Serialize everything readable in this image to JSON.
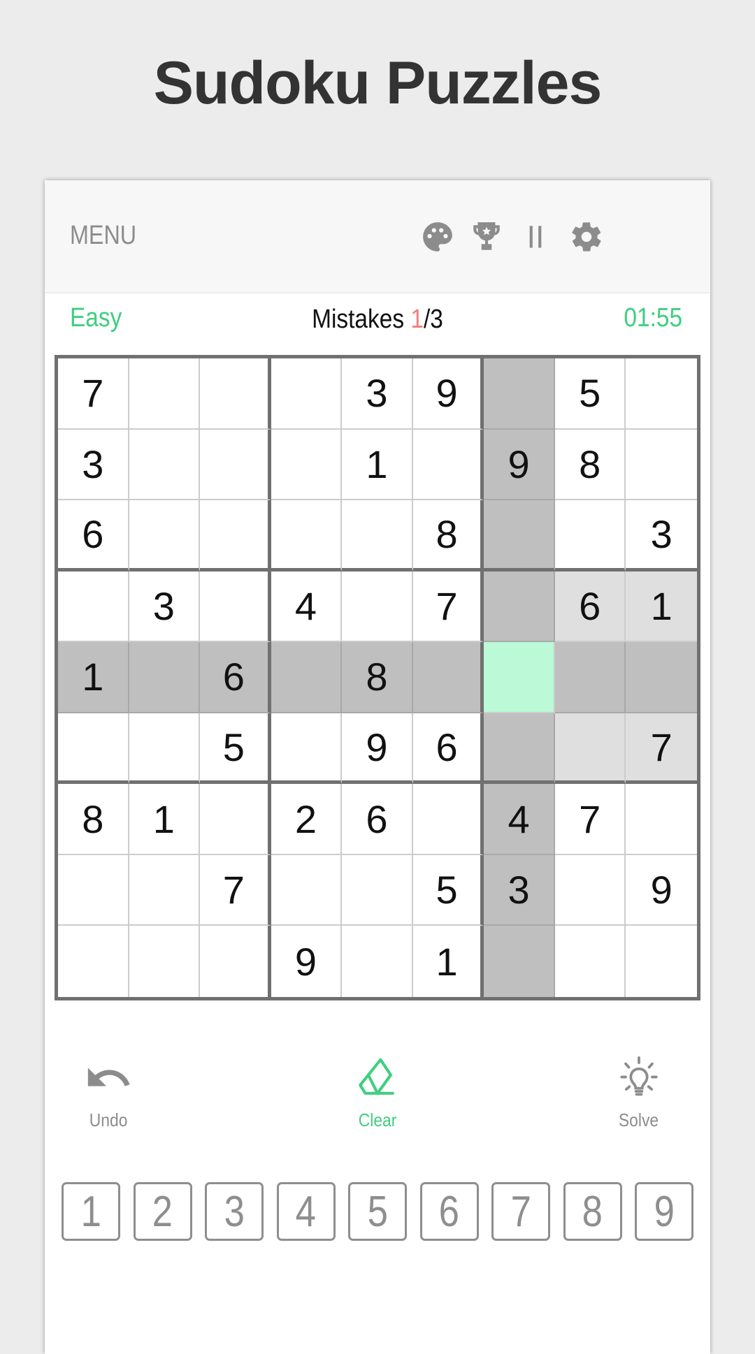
{
  "title": "Sudoku Puzzles",
  "topbar": {
    "menu_label": "MENU",
    "icons": [
      "palette-icon",
      "trophy-icon",
      "pause-icon",
      "settings-gear-icon"
    ]
  },
  "status": {
    "difficulty": "Easy",
    "mistakes_label": "Mistakes",
    "mistakes_count": "1",
    "mistakes_max": "/3",
    "timer": "01:55"
  },
  "colors": {
    "accent": "#3ecf7e",
    "mistake": "#ef7f7f",
    "selected_cell": "#bbf9d7",
    "line_highlight": "#bfbfbf",
    "box_highlight": "#dfdfdf",
    "grid_border": "#707070"
  },
  "board": {
    "selected": {
      "row": 4,
      "col": 6
    },
    "cells": [
      [
        "7",
        "",
        "",
        "",
        "3",
        "9",
        "",
        "5",
        ""
      ],
      [
        "3",
        "",
        "",
        "",
        "1",
        "",
        "9",
        "8",
        ""
      ],
      [
        "6",
        "",
        "",
        "",
        "",
        "8",
        "",
        "",
        "3"
      ],
      [
        "",
        "3",
        "",
        "4",
        "",
        "7",
        "",
        "6",
        "1"
      ],
      [
        "1",
        "",
        "6",
        "",
        "8",
        "",
        "",
        "",
        ""
      ],
      [
        "",
        "",
        "5",
        "",
        "9",
        "6",
        "",
        "",
        "7"
      ],
      [
        "8",
        "1",
        "",
        "2",
        "6",
        "",
        "4",
        "7",
        ""
      ],
      [
        "",
        "",
        "7",
        "",
        "",
        "5",
        "3",
        "",
        "9"
      ],
      [
        "",
        "",
        "",
        "9",
        "",
        "1",
        "",
        "",
        ""
      ]
    ]
  },
  "actions": [
    {
      "label": "Undo",
      "icon": "undo-icon",
      "active": false
    },
    {
      "label": "Clear",
      "icon": "eraser-icon",
      "active": true
    },
    {
      "label": "Solve",
      "icon": "lightbulb-icon",
      "active": false
    }
  ],
  "numpad": [
    "1",
    "2",
    "3",
    "4",
    "5",
    "6",
    "7",
    "8",
    "9"
  ]
}
